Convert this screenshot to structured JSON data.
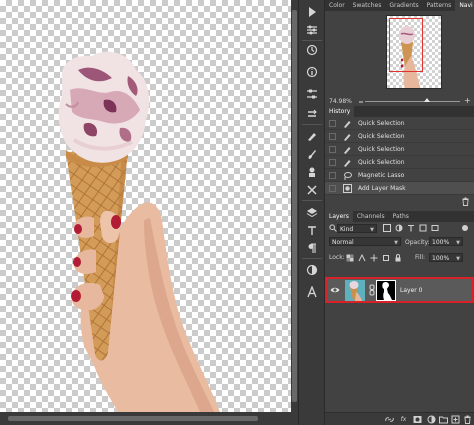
{
  "panel_tabs": {
    "top": [
      "Color",
      "Swatches",
      "Gradients",
      "Patterns",
      "Navi"
    ],
    "history": "History",
    "layers": [
      "Layers",
      "Channels",
      "Paths"
    ]
  },
  "navigator": {
    "zoom": "74.98%"
  },
  "history": {
    "items": [
      {
        "label": "Quick Selection",
        "icon": "brush-icon"
      },
      {
        "label": "Quick Selection",
        "icon": "brush-icon"
      },
      {
        "label": "Quick Selection",
        "icon": "brush-icon"
      },
      {
        "label": "Quick Selection",
        "icon": "brush-icon"
      },
      {
        "label": "Magnetic Lasso",
        "icon": "lasso-icon"
      },
      {
        "label": "Add Layer Mask",
        "icon": "mask-icon"
      }
    ]
  },
  "layers": {
    "filter_kind": "Kind",
    "blend_mode": "Normal",
    "opacity_label": "Opacity:",
    "opacity_value": "100%",
    "lock_label": "Lock:",
    "fill_label": "Fill:",
    "fill_value": "100%",
    "layer_name": "Layer 0"
  },
  "colors": {
    "highlight_border": "#d8222a",
    "panel_bg": "#424242",
    "toolbar_bg": "#3a3a3a"
  }
}
